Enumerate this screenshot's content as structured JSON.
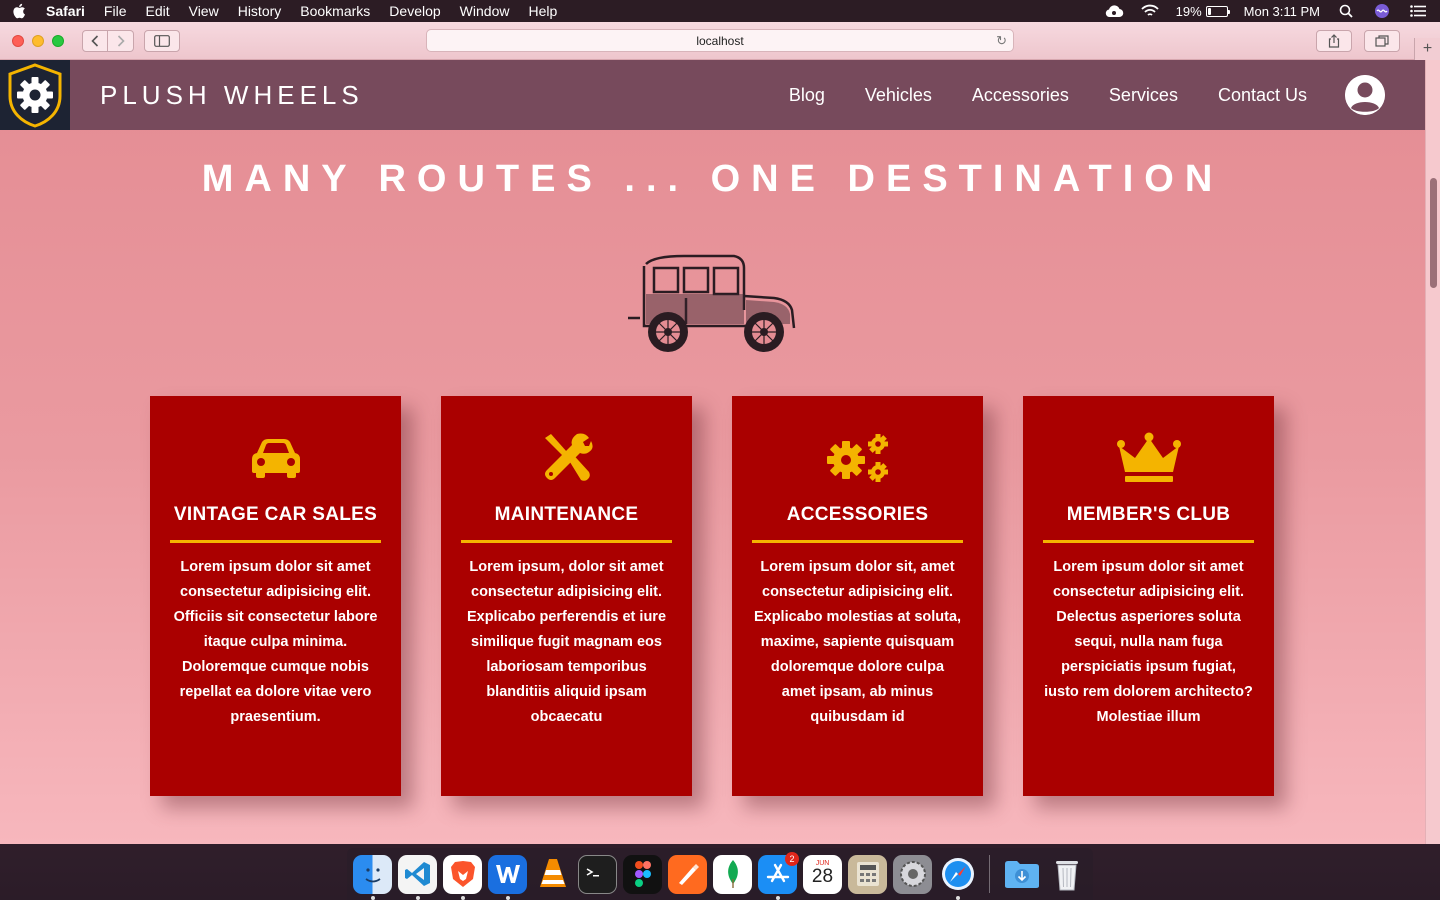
{
  "menubar": {
    "app_name": "Safari",
    "items": [
      "File",
      "Edit",
      "View",
      "History",
      "Bookmarks",
      "Develop",
      "Window",
      "Help"
    ],
    "battery_percent": "19%",
    "battery_level": 0.19,
    "clock": "Mon 3:11 PM"
  },
  "browser": {
    "url": "localhost"
  },
  "site": {
    "brand": "PLUSH WHEELS",
    "nav": [
      "Blog",
      "Vehicles",
      "Accessories",
      "Services",
      "Contact Us"
    ],
    "hero_title": "MANY ROUTES ... ONE DESTINATION",
    "colors": {
      "header": "#774a5c",
      "card": "#aa0000",
      "accent": "#f4b400"
    },
    "cards": [
      {
        "icon": "car-icon",
        "title": "VINTAGE CAR SALES",
        "text": "Lorem ipsum dolor sit amet consectetur adipisicing elit. Officiis sit consectetur labore itaque culpa minima. Doloremque cumque nobis repellat ea dolore vitae vero praesentium."
      },
      {
        "icon": "tools-icon",
        "title": "MAINTENANCE",
        "text": "Lorem ipsum, dolor sit amet consectetur adipisicing elit. Explicabo perferendis et iure similique fugit magnam eos laboriosam temporibus blanditiis aliquid ipsam obcaecatu"
      },
      {
        "icon": "cogs-icon",
        "title": "ACCESSORIES",
        "text": "Lorem ipsum dolor sit, amet consectetur adipisicing elit. Explicabo molestias at soluta, maxime, sapiente quisquam doloremque dolore culpa amet ipsam, ab minus quibusdam id"
      },
      {
        "icon": "crown-icon",
        "title": "MEMBER'S CLUB",
        "text": "Lorem ipsum dolor sit amet consectetur adipisicing elit. Delectus asperiores soluta sequi, nulla nam fuga perspiciatis ipsum fugiat, iusto rem dolorem architecto? Molestiae illum"
      }
    ]
  },
  "dock": {
    "apps": [
      "Finder",
      "Visual Studio Code",
      "Brave",
      "Word",
      "VLC",
      "Terminal",
      "Figma",
      "Vectornator",
      "MongoDB Compass",
      "App Store",
      "Calendar",
      "Calculator",
      "System Preferences",
      "Safari",
      "Downloads",
      "Trash"
    ],
    "app_store_badge": "2",
    "calendar_month": "JUN",
    "calendar_day": "28"
  }
}
